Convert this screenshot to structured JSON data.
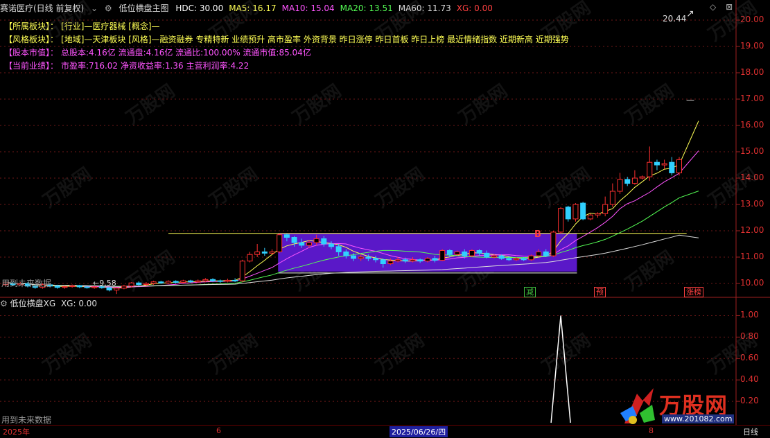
{
  "header": {
    "stock": "赛诺医疗(日线 前复权)",
    "indicator": "低位横盘主图",
    "values": [
      {
        "label": "HDC: 30.00",
        "color": "#ffffff"
      },
      {
        "label": "MA5: 16.17",
        "color": "#ffff55"
      },
      {
        "label": "MA10: 15.04",
        "color": "#ff55ff"
      },
      {
        "label": "MA20: 13.51",
        "color": "#55ff55"
      },
      {
        "label": "MA60: 11.73",
        "color": "#dddddd"
      },
      {
        "label": "XG: 0.00",
        "color": "#ff4040"
      }
    ]
  },
  "info": [
    {
      "label": "【所属板块】：",
      "text": "[行业]—医疗器械 [概念]—",
      "color": "#ffff55"
    },
    {
      "label": "【风格板块】：",
      "text": "[地域]—天津板块 [风格]—融资融券 专精特新 业绩预升 高市盈率 外资背景 昨日涨停 昨日首板 昨日上榜 最近情绪指数 近期新高 近期强势",
      "color": "#ffff55"
    },
    {
      "label": "【股本市值】：",
      "text": "总股本:4.16亿 流通盘:4.16亿 流通比:100.00% 流通市值:85.04亿",
      "color": "#ff55ff"
    },
    {
      "label": "【当前业绩】：",
      "text": "市盈率:716.02 净资收益率:1.36 主营利润率:4.22",
      "color": "#ff55ff"
    }
  ],
  "price_axis": [
    "20.00",
    "19.00",
    "18.00",
    "17.00",
    "16.00",
    "15.00",
    "14.00",
    "13.00",
    "12.00",
    "11.00",
    "10.00"
  ],
  "indicator_axis": [
    "1.00",
    "0.80",
    "0.60",
    "0.40",
    "0.20"
  ],
  "annotations": {
    "high": "20.44",
    "low": "9.58",
    "future_note": "用到未来数据",
    "b_mark": "B"
  },
  "badges": [
    {
      "label": "减",
      "color": "#40c040"
    },
    {
      "label": "预",
      "color": "#ff4040"
    },
    {
      "label": "涨榜",
      "color": "#ff4040"
    }
  ],
  "sub": {
    "title": "低位横盘XG",
    "value": "XG: 0.00",
    "future_note": "用到未来数据"
  },
  "bottom": {
    "year": "2025年",
    "m1": "6",
    "date": "2025/06/26/四",
    "m2": "8",
    "period": "日线"
  },
  "watermark": {
    "brand": "万股网",
    "url": "www.201082.com"
  },
  "chart_data": {
    "type": "candlestick",
    "ylim": [
      9.5,
      20.5
    ],
    "candles": [
      [
        9.95,
        10.05,
        9.9,
        10.1
      ],
      [
        10.0,
        9.95,
        9.9,
        10.05
      ],
      [
        9.95,
        10.0,
        9.92,
        10.05
      ],
      [
        10.0,
        9.9,
        9.85,
        10.05
      ],
      [
        9.9,
        9.85,
        9.8,
        9.95
      ],
      [
        9.85,
        9.95,
        9.8,
        10.0
      ],
      [
        9.95,
        9.9,
        9.85,
        10.0
      ],
      [
        9.9,
        9.85,
        9.8,
        9.95
      ],
      [
        9.85,
        9.88,
        9.8,
        9.92
      ],
      [
        9.88,
        9.92,
        9.84,
        9.96
      ],
      [
        9.92,
        9.87,
        9.82,
        9.95
      ],
      [
        9.87,
        9.84,
        9.8,
        9.9
      ],
      [
        9.84,
        9.87,
        9.8,
        9.9
      ],
      [
        9.87,
        9.84,
        9.8,
        9.9
      ],
      [
        9.84,
        9.75,
        9.7,
        9.86
      ],
      [
        9.75,
        9.82,
        9.6,
        9.85
      ],
      [
        9.82,
        9.9,
        9.78,
        9.95
      ],
      [
        9.9,
        10.02,
        9.85,
        10.05
      ],
      [
        10.02,
        9.96,
        9.92,
        10.08
      ],
      [
        9.96,
        10.0,
        9.9,
        10.05
      ],
      [
        10.0,
        10.06,
        9.95,
        10.1
      ],
      [
        10.06,
        10.02,
        9.98,
        10.1
      ],
      [
        10.02,
        10.08,
        9.98,
        10.12
      ],
      [
        10.08,
        10.04,
        10.0,
        10.12
      ],
      [
        10.04,
        10.1,
        10.0,
        10.14
      ],
      [
        10.1,
        10.06,
        10.02,
        10.14
      ],
      [
        10.06,
        10.1,
        10.02,
        10.15
      ],
      [
        10.1,
        10.15,
        10.05,
        10.2
      ],
      [
        10.15,
        10.1,
        10.05,
        10.2
      ],
      [
        10.1,
        10.08,
        10.02,
        10.15
      ],
      [
        10.08,
        10.12,
        10.04,
        10.18
      ],
      [
        10.12,
        10.1,
        10.05,
        10.2
      ],
      [
        10.1,
        10.85,
        10.05,
        10.9
      ],
      [
        10.85,
        11.1,
        10.8,
        11.2
      ],
      [
        11.1,
        11.2,
        11.0,
        11.5
      ],
      [
        11.2,
        11.15,
        11.05,
        11.35
      ],
      [
        11.15,
        11.2,
        11.1,
        11.3
      ],
      [
        11.2,
        11.85,
        11.15,
        11.9
      ],
      [
        11.85,
        11.75,
        11.6,
        11.9
      ],
      [
        11.75,
        11.55,
        11.4,
        11.8
      ],
      [
        11.55,
        11.45,
        11.35,
        11.7
      ],
      [
        11.45,
        11.55,
        11.35,
        11.65
      ],
      [
        11.55,
        11.7,
        11.45,
        11.85
      ],
      [
        11.7,
        11.5,
        11.4,
        11.8
      ],
      [
        11.5,
        11.4,
        11.3,
        11.6
      ],
      [
        11.4,
        11.2,
        11.05,
        11.5
      ],
      [
        11.2,
        11.05,
        10.95,
        11.3
      ],
      [
        11.05,
        10.95,
        10.85,
        11.15
      ],
      [
        10.95,
        11.0,
        10.85,
        11.1
      ],
      [
        11.0,
        10.95,
        10.85,
        11.1
      ],
      [
        10.95,
        10.9,
        10.8,
        11.05
      ],
      [
        10.9,
        10.75,
        10.6,
        10.95
      ],
      [
        10.75,
        10.85,
        10.7,
        10.95
      ],
      [
        10.85,
        10.9,
        10.8,
        11.0
      ],
      [
        10.9,
        10.85,
        10.78,
        10.98
      ],
      [
        10.85,
        10.9,
        10.8,
        11.0
      ],
      [
        10.9,
        10.85,
        10.78,
        10.95
      ],
      [
        10.85,
        10.95,
        10.8,
        11.0
      ],
      [
        10.95,
        10.88,
        10.8,
        11.05
      ],
      [
        10.88,
        11.25,
        10.85,
        11.3
      ],
      [
        11.25,
        11.1,
        11.0,
        11.3
      ],
      [
        11.1,
        11.2,
        11.05,
        11.25
      ],
      [
        11.2,
        11.05,
        10.95,
        11.3
      ],
      [
        11.05,
        11.25,
        11.0,
        11.3
      ],
      [
        11.25,
        11.15,
        11.05,
        11.3
      ],
      [
        11.15,
        11.0,
        10.95,
        11.25
      ],
      [
        11.0,
        11.05,
        10.95,
        11.1
      ],
      [
        11.05,
        10.95,
        10.9,
        11.1
      ],
      [
        10.95,
        10.9,
        10.85,
        11.05
      ],
      [
        10.9,
        10.95,
        10.85,
        11.0
      ],
      [
        10.95,
        10.9,
        10.85,
        11.0
      ],
      [
        10.9,
        11.05,
        10.85,
        11.1
      ],
      [
        11.05,
        11.2,
        11.0,
        11.3
      ],
      [
        11.2,
        11.05,
        11.0,
        11.3
      ],
      [
        11.05,
        11.95,
        11.0,
        12.0
      ],
      [
        11.95,
        12.85,
        11.9,
        12.9
      ],
      [
        12.9,
        12.45,
        12.35,
        12.95
      ],
      [
        12.45,
        13.0,
        12.35,
        13.05
      ],
      [
        13.05,
        12.45,
        12.4,
        13.1
      ],
      [
        12.45,
        12.6,
        12.4,
        12.65
      ],
      [
        12.6,
        12.65,
        12.5,
        12.7
      ],
      [
        12.65,
        13.0,
        12.55,
        13.3
      ],
      [
        13.0,
        13.5,
        12.9,
        13.8
      ],
      [
        13.5,
        13.95,
        13.4,
        14.2
      ],
      [
        13.95,
        13.8,
        13.7,
        14.05
      ],
      [
        13.8,
        14.0,
        13.75,
        14.3
      ],
      [
        14.0,
        14.05,
        13.95,
        14.1
      ],
      [
        14.05,
        14.6,
        13.9,
        15.2
      ],
      [
        14.6,
        14.5,
        14.3,
        14.7
      ],
      [
        14.5,
        14.55,
        14.35,
        14.7
      ],
      [
        14.6,
        14.2,
        14.1,
        14.8
      ],
      [
        14.2,
        14.7,
        14.1,
        14.8
      ]
    ],
    "box": {
      "top": 11.9,
      "bottom": 10.45
    },
    "level_line": 11.9,
    "indicator": {
      "type": "spike",
      "ylim": [
        0,
        1.1
      ],
      "peak_value": 1.0
    }
  }
}
